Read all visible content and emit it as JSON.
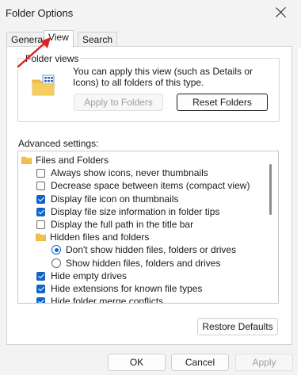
{
  "window": {
    "title": "Folder Options"
  },
  "tabs": [
    {
      "label": "General",
      "active": false
    },
    {
      "label": "View",
      "active": true
    },
    {
      "label": "Search",
      "active": false
    }
  ],
  "folder_views": {
    "group_label": "Folder views",
    "description": "You can apply this view (such as Details or Icons) to all folders of this type.",
    "apply_button": "Apply to Folders",
    "reset_button": "Reset Folders"
  },
  "advanced": {
    "label": "Advanced settings:",
    "items": [
      {
        "type": "folder",
        "label": "Files and Folders"
      },
      {
        "type": "checkbox",
        "label": "Always show icons, never thumbnails",
        "checked": false
      },
      {
        "type": "checkbox",
        "label": "Decrease space between items (compact view)",
        "checked": false
      },
      {
        "type": "checkbox",
        "label": "Display file icon on thumbnails",
        "checked": true
      },
      {
        "type": "checkbox",
        "label": "Display file size information in folder tips",
        "checked": true
      },
      {
        "type": "checkbox",
        "label": "Display the full path in the title bar",
        "checked": false
      },
      {
        "type": "folder",
        "label": "Hidden files and folders"
      },
      {
        "type": "radio",
        "label": "Don't show hidden files, folders or drives",
        "checked": true
      },
      {
        "type": "radio",
        "label": "Show hidden files, folders and drives",
        "checked": false
      },
      {
        "type": "checkbox",
        "label": "Hide empty drives",
        "checked": true
      },
      {
        "type": "checkbox",
        "label": "Hide extensions for known file types",
        "checked": true
      },
      {
        "type": "checkbox",
        "label": "Hide folder merge conflicts",
        "checked": true
      }
    ],
    "restore_button": "Restore Defaults"
  },
  "footer": {
    "ok": "OK",
    "cancel": "Cancel",
    "apply": "Apply"
  },
  "colors": {
    "accent": "#1164c6",
    "annotation_arrow": "#e02020",
    "folder": "#f0c14b"
  },
  "icons": {
    "close": "close-icon",
    "folder_view": "folder-view-icon",
    "small_folder": "folder-icon"
  }
}
